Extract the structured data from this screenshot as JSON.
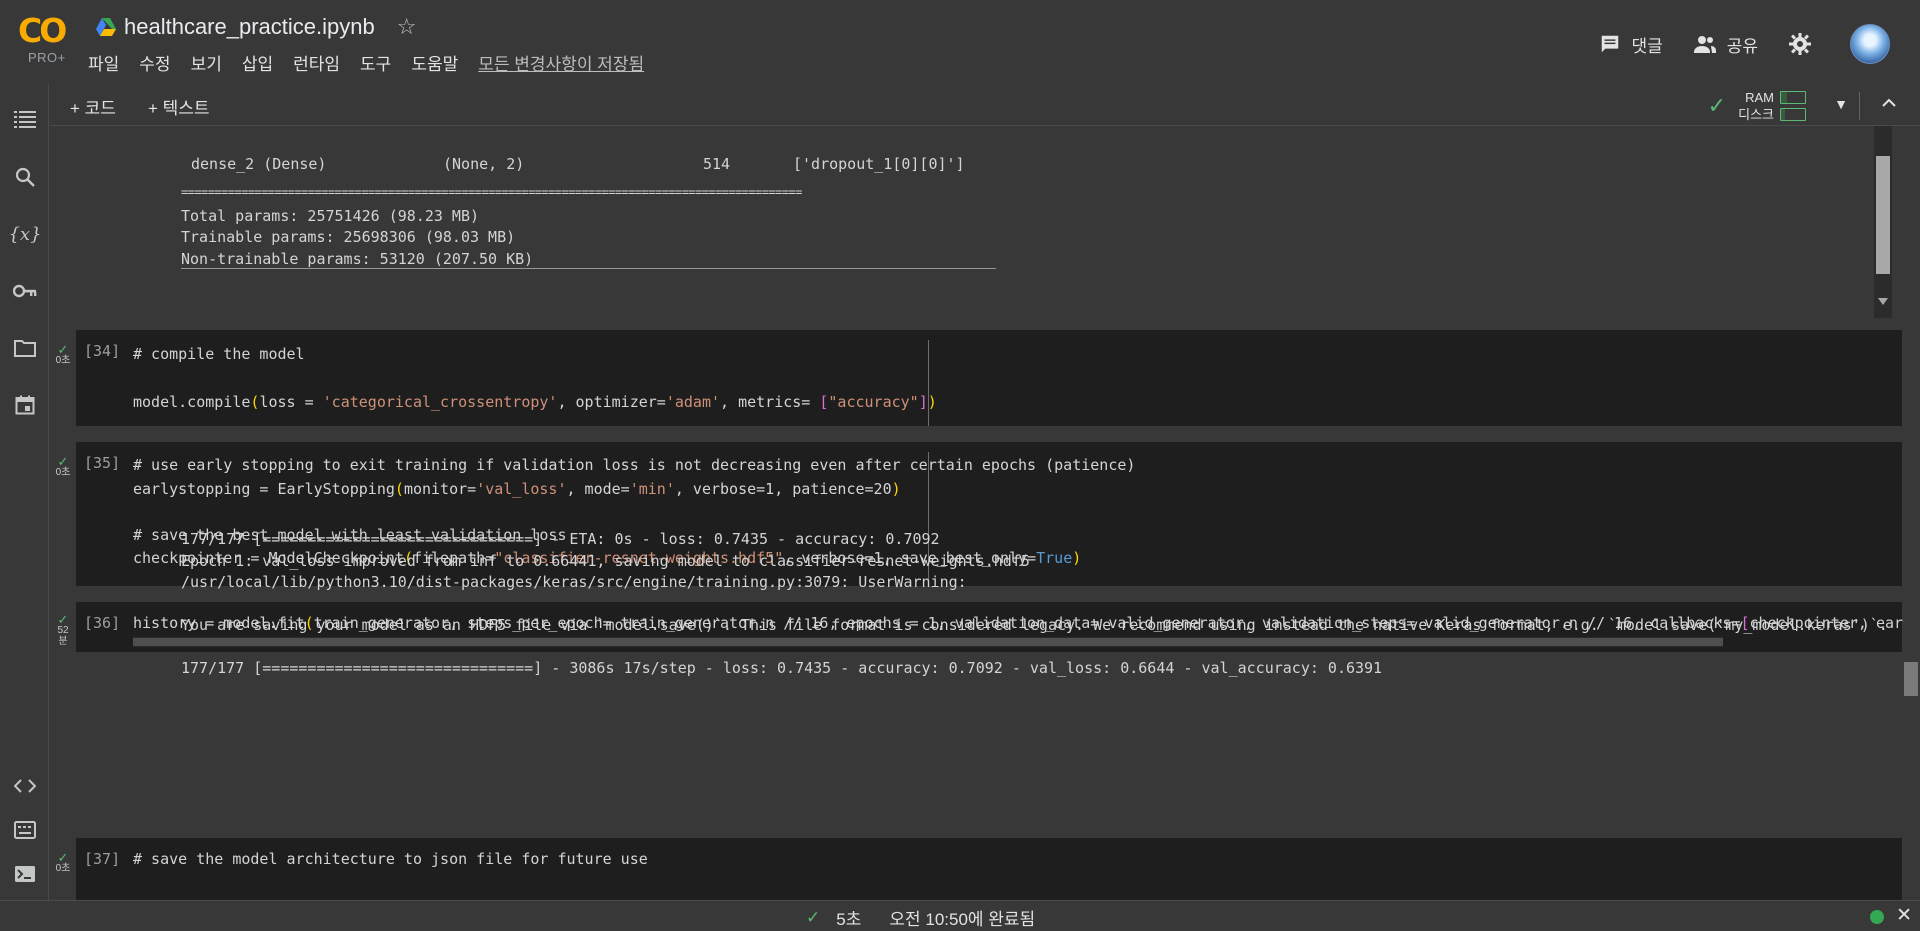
{
  "header": {
    "logo_text": "CO",
    "plan_label": "PRO+",
    "filename": "healthcare_practice.ipynb",
    "menu": [
      "파일",
      "수정",
      "보기",
      "삽입",
      "런타임",
      "도구",
      "도움말"
    ],
    "saved_status": "모든 변경사항이 저장됨",
    "comment_label": "댓글",
    "share_label": "공유"
  },
  "toolbar": {
    "add_code_label": "+ 코드",
    "add_text_label": "+ 텍스트",
    "ram_label": "RAM",
    "disk_label": "디스크",
    "ram_usage": 0.25,
    "disk_usage": 0.15
  },
  "output_top": {
    "row_layer": "dense_2 (Dense)",
    "row_shape": "(None, 2)",
    "row_params": "514",
    "row_connected": "['dropout_1[0][0]']",
    "separator": "=============================================================================================",
    "total_params": "Total params: 25751426 (98.23 MB)",
    "trainable_params": "Trainable params: 25698306 (98.03 MB)",
    "non_trainable_params": "Non-trainable params: 53120 (207.50 KB)",
    "underline": "_____________________________________________________________________________________________"
  },
  "cells": {
    "c34": {
      "exec": "[34]",
      "status_time": "0초",
      "l1": "# compile the model",
      "l2a": "model.compile",
      "l2b": "(",
      "l2c": "loss = ",
      "l2d": "'categorical_crossentropy'",
      "l2e": ", optimizer=",
      "l2f": "'adam'",
      "l2g": ", metrics= ",
      "l2h": "[",
      "l2i": "\"accuracy\"",
      "l2j": "]",
      "l2k": ")"
    },
    "c35": {
      "exec": "[35]",
      "status_time": "0초",
      "l1": "# use early stopping to exit training if validation loss is not decreasing even after certain epochs (patience)",
      "l2a": "earlystopping = EarlyStopping",
      "l2b": "(",
      "l2c": "monitor=",
      "l2d": "'val_loss'",
      "l2e": ", mode=",
      "l2f": "'min'",
      "l2g": ", verbose=1, patience=20",
      "l2h": ")",
      "l3": "# save the best model with least validation loss",
      "l4a": "checkpointer = ModelCheckpoint",
      "l4b": "(",
      "l4c": "filepath=",
      "l4d": "\"classifier-resnet-weights.hdf5\"",
      "l4e": ", verbose=1, save_best_only=",
      "l4f": "True",
      "l4g": ")"
    },
    "c36": {
      "exec": "[36]",
      "status_time": "52",
      "status_unit": "분",
      "l1a": "history = model.fit",
      "l1b": "(",
      "l1c": "train_generator, steps_per_epoch= train_generator.n // 16, epochs = 1, validation_data= valid_generator, validation_steps= valid_generator.n // 16, callbacks=",
      "l1d": "[",
      "l1e": "checkpointer, ear",
      "o1": "177/177 [==============================] - ETA: 0s - loss: 0.7435 - accuracy: 0.7092",
      "o2": "Epoch 1: val_loss improved from inf to 0.66441, saving model to classifier-resnet-weights.hdf5",
      "o3": "/usr/local/lib/python3.10/dist-packages/keras/src/engine/training.py:3079: UserWarning:",
      "o4": "You are saving your model as an HDF5 file via `model.save()`. This file format is considered legacy. We recommend using instead the native Keras format, e.g. `model.save('my_model.keras')`.",
      "o5": "177/177 [==============================] - 3086s 17s/step - loss: 0.7435 - accuracy: 0.7092 - val_loss: 0.6644 - val_accuracy: 0.6391"
    },
    "c37": {
      "exec": "[37]",
      "status_time": "0초",
      "l1": "# save the model architecture to json file for future use"
    }
  },
  "statusbar": {
    "duration": "5초",
    "completed": "오전 10:50에 완료됨"
  },
  "colors": {
    "accent_green": "#5bb974",
    "logo_orange": "#f9ab00",
    "comment": "#6a9955",
    "string": "#ce9178",
    "keyword": "#569cd6"
  }
}
